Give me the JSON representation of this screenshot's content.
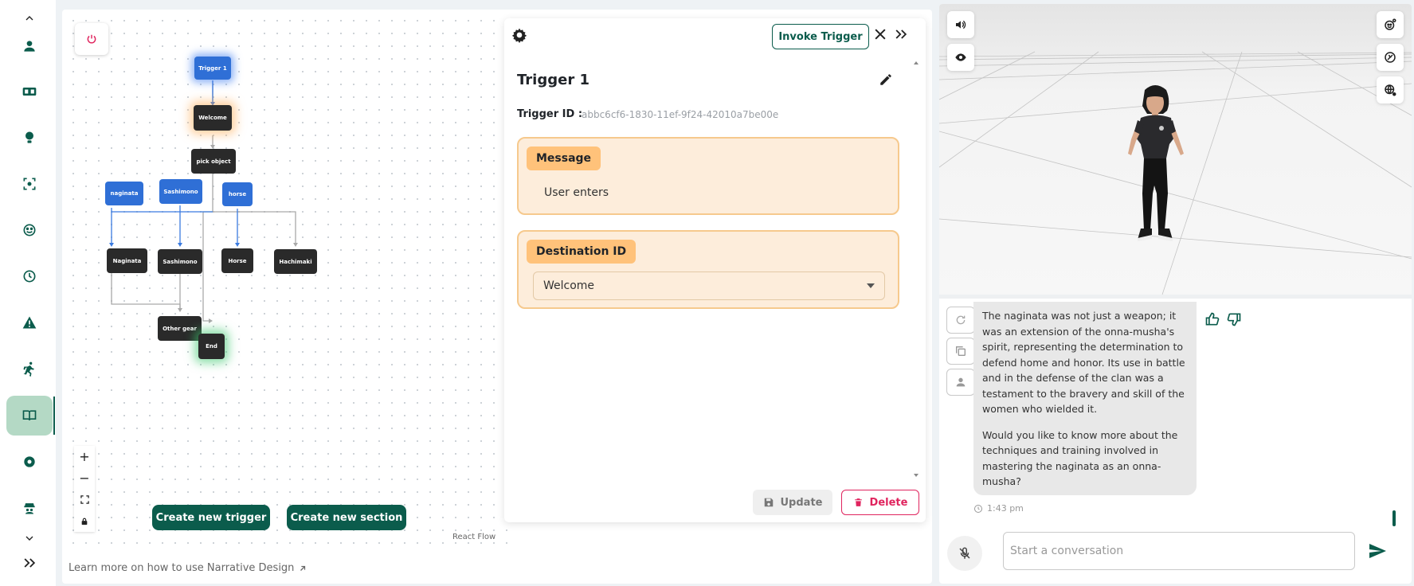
{
  "nav": {
    "items": [
      "profile",
      "translate",
      "ideas",
      "scan",
      "emotion",
      "history",
      "warning",
      "action",
      "narrative-design",
      "settings",
      "agent"
    ],
    "active": "narrative-design"
  },
  "flow": {
    "nodes": {
      "trigger1": "Trigger 1",
      "welcome": "Welcome",
      "pick_object": "pick object",
      "naginata_trigger": "naginata",
      "sashimono_trigger": "Sashimono",
      "horse_trigger": "horse",
      "naginata": "Naginata",
      "sashimono": "Sashimono",
      "horse": "Horse",
      "hachimaki": "Hachimaki",
      "other_gear": "Other gear",
      "end": "End"
    },
    "create_trigger_label": "Create new trigger",
    "create_section_label": "Create new section",
    "react_flow_label": "React Flow",
    "learn_more": "Learn more on how to use Narrative Design"
  },
  "panel": {
    "invoke_label": "Invoke Trigger",
    "title": "Trigger 1",
    "trigger_id_label": "Trigger ID :",
    "trigger_id_value": "abbc6cf6-1830-11ef-9f24-42010a7be00e",
    "message_tag": "Message",
    "message_text": "User enters",
    "destination_tag": "Destination ID",
    "destination_value": "Welcome",
    "update_label": "Update",
    "delete_label": "Delete"
  },
  "chat": {
    "message_p1": "The naginata was not just a weapon; it was an extension of the onna-musha's spirit, representing the determination to defend home and honor. Its use in battle and in the defense of the clan was a testament to the bravery and skill of the women who wielded it.",
    "message_p2": "Would you like to know more about the techniques and training involved in mastering the naginata as an onna-musha?",
    "time": "1:43 pm",
    "input_placeholder": "Start a conversation"
  },
  "colors": {
    "brand": "#0b5c4c",
    "node_blue": "#2f6fd6",
    "node_dark": "#2a2a2a",
    "card_bg": "#fdeddb",
    "card_tag": "#ffc27a",
    "danger": "#e0245e"
  }
}
